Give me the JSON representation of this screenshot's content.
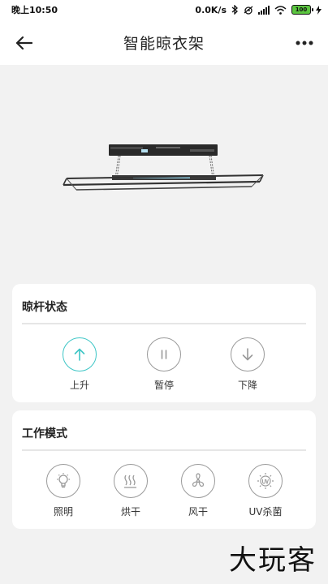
{
  "status_bar": {
    "time": "晚上10:50",
    "speed": "0.0K/s",
    "battery": "100"
  },
  "header": {
    "title": "智能晾衣架",
    "back_icon": "arrow-left-icon",
    "more_icon": "more-dots-icon"
  },
  "pole_status": {
    "title": "晾杆状态",
    "buttons": [
      {
        "label": "上升",
        "icon": "arrow-up-icon",
        "active": true
      },
      {
        "label": "暂停",
        "icon": "pause-icon",
        "active": false
      },
      {
        "label": "下降",
        "icon": "arrow-down-icon",
        "active": false
      }
    ]
  },
  "work_mode": {
    "title": "工作模式",
    "buttons": [
      {
        "label": "照明",
        "icon": "bulb-icon"
      },
      {
        "label": "烘干",
        "icon": "heat-icon"
      },
      {
        "label": "风干",
        "icon": "fan-icon"
      },
      {
        "label": "UV杀菌",
        "icon": "uv-icon"
      }
    ]
  },
  "watermark": "大玩客",
  "colors": {
    "accent": "#3ec6c6",
    "icon_gray": "#9a9a9a",
    "background": "#f2f2f2"
  }
}
